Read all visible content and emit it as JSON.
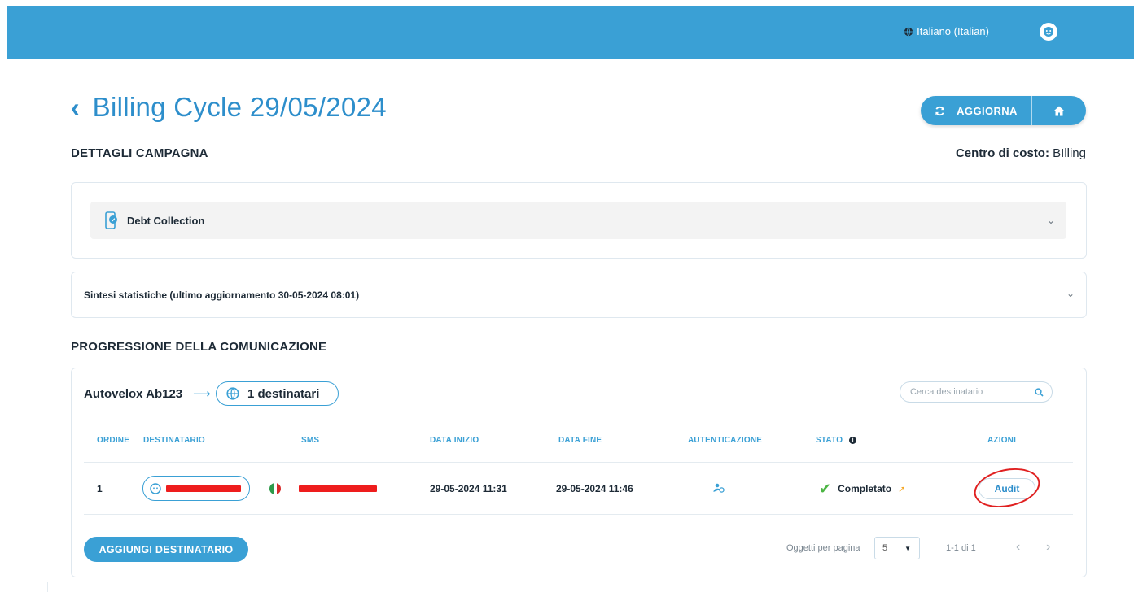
{
  "header": {
    "language": "Italiano (Italian)",
    "icons": {
      "language": "globe-icon",
      "user": "user-avatar-icon"
    }
  },
  "page": {
    "title": "Billing Cycle 29/05/2024",
    "refresh_label": "AGGIORNA",
    "section_details": "DETTAGLI CAMPAGNA",
    "cost_center_label": "Centro di costo:",
    "cost_center_value": "BIlling"
  },
  "campaign": {
    "type": "Debt Collection"
  },
  "stats": {
    "label": "Sintesi statistiche (ultimo aggiornamento 30-05-2024 08:01)"
  },
  "progression": {
    "section_title": "PROGRESSIONE DELLA COMUNICAZIONE",
    "flow_name": "Autovelox Ab123",
    "recipients_label": "1 destinatari",
    "search_placeholder": "Cerca destinatario",
    "columns": {
      "order": "ORDINE",
      "recipient": "DESTINATARIO",
      "sms": "SMS",
      "start": "DATA INIZIO",
      "end": "DATA FINE",
      "auth": "AUTENTICAZIONE",
      "status": "STATO",
      "actions": "AZIONI"
    },
    "rows": [
      {
        "order": "1",
        "start": "29-05-2024 11:31",
        "end": "29-05-2024 11:46",
        "status": "Completato",
        "action": "Audit"
      }
    ],
    "add_recipient": "AGGIUNGI DESTINATARIO",
    "per_page_label": "Oggetti per pagina",
    "per_page_value": "5",
    "range": "1-1 di 1"
  },
  "colors": {
    "primary": "#3aa0d5",
    "title": "#2d8ecb",
    "success": "#4bb543",
    "redaction": "#ee1d1d",
    "highlight": "#e02020"
  }
}
